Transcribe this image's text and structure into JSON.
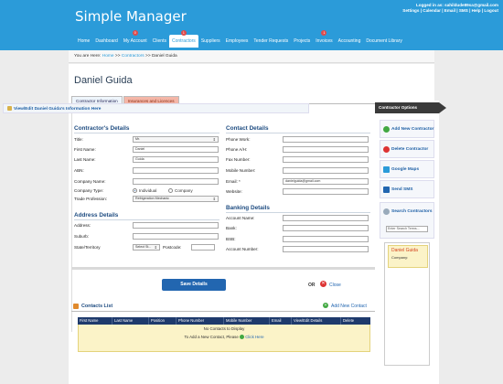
{
  "header": {
    "logo": "Simple Manager",
    "logged_in": "Logged in as: sahildude89sa@gmail.com",
    "links": "Settings | Calendar | Email | SMS | Help | Logout"
  },
  "nav": [
    {
      "label": "Home"
    },
    {
      "label": "Dashboard"
    },
    {
      "label": "My Account",
      "badge": "0"
    },
    {
      "label": "Clients"
    },
    {
      "label": "Contractors",
      "badge": "1",
      "active": true
    },
    {
      "label": "Suppliers"
    },
    {
      "label": "Employees"
    },
    {
      "label": "Tender Requests"
    },
    {
      "label": "Projects"
    },
    {
      "label": "Invoices",
      "badge": "1"
    },
    {
      "label": "Accounting"
    },
    {
      "label": "Document Library"
    }
  ],
  "breadcrumb": {
    "prefix": "You are Here:",
    "home": "Home",
    "sep": ">>",
    "contractors": "Contractors",
    "current": "Daniel Guida"
  },
  "page": {
    "title": "Daniel Guida",
    "tabs": [
      "Contractor Information",
      "Insurances and Licences"
    ],
    "view_edit": "View/Edit Daniel Guida's Information Here"
  },
  "contractor_details": {
    "title": "Contractor's Details",
    "fields": {
      "title_label": "Title:",
      "title_value": "Mr.",
      "first_label": "First Name:",
      "first_value": "Daniel",
      "last_label": "Last Name:",
      "last_value": "Guida",
      "abn_label": "ABN:",
      "abn_value": "",
      "company_label": "Company Name:",
      "company_value": "",
      "type_label": "Company Type:",
      "type_opt1": "Individual",
      "type_opt2": "Company",
      "trade_label": "Trade Profession:",
      "trade_value": "Refrigeration Mechanic"
    }
  },
  "address_details": {
    "title": "Address Details",
    "address_label": "Address:",
    "suburb_label": "Suburb:",
    "state_label": "State/Territory",
    "state_value": "Select St...",
    "postcode_label": "Postcode:"
  },
  "contact_details": {
    "title": "Contact Details",
    "phone_work": "Phone Work:",
    "phone_ah": "Phone A/H:",
    "fax": "Fax Number:",
    "mobile": "Mobile Number:",
    "email": "Email: *",
    "email_value": "danielguida@gmail.com",
    "website": "Website:"
  },
  "banking_details": {
    "title": "Banking Details",
    "account_name": "Account Name:",
    "bank": "Bank:",
    "bsb": "BSB:",
    "account_number": "Account Number:"
  },
  "actions": {
    "save": "Save Details",
    "or": "OR",
    "close": "Close"
  },
  "contacts": {
    "title": "Contacts List",
    "add": "Add New Contact",
    "columns": [
      "First Name",
      "Last Name",
      "Position",
      "Phone Number",
      "Mobile Number",
      "Email",
      "View/Edit Details",
      "Delete"
    ],
    "empty_line1": "No Contacts to Display",
    "empty_line2_prefix": "To Add a New Contact, Please",
    "empty_line2_link": "Click Here"
  },
  "sidebar": {
    "title": "Contractor Options",
    "items": [
      {
        "label": "Add New Contractor",
        "color": "#42a842"
      },
      {
        "label": "Delete Contractor",
        "color": "#d33"
      },
      {
        "label": "Google Maps",
        "color": "#2b9bd9"
      },
      {
        "label": "Send SMS",
        "color": "#2266b0"
      }
    ],
    "search_title": "Search Contractors",
    "search_placeholder": "Enter Search Terms...",
    "result_name": "Daniel Guida",
    "result_company": "Company:"
  },
  "colors": {
    "header": "#2b9bd9",
    "nav_badge": "#e04b4b",
    "save_button": "#2266b0",
    "table_header": "#1e3a6c",
    "empty_row": "#fbf3c8"
  }
}
